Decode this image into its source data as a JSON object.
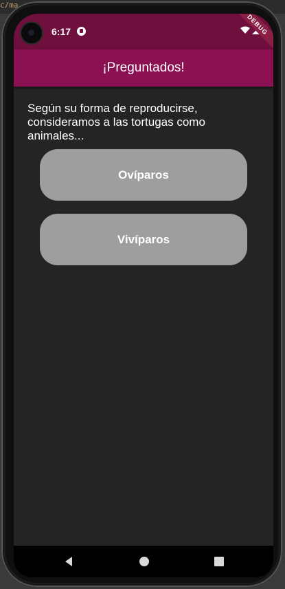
{
  "editor": {
    "path_fragment": "c/ma"
  },
  "status_bar": {
    "time": "6:17",
    "debug_badge": "DEBUG"
  },
  "app_bar": {
    "title": "¡Preguntados!"
  },
  "question": {
    "text": "Según su forma de reproducirse, consideramos a las tortugas como animales..."
  },
  "answers": [
    {
      "label": "Ovíparos"
    },
    {
      "label": "Vivíparos"
    }
  ],
  "colors": {
    "status_bar": "#6e0f3e",
    "app_bar": "#8b1153",
    "background": "#242424",
    "button": "#9e9e9e"
  },
  "icons": {
    "status": [
      "wifi-icon",
      "signal-icon",
      "battery-icon"
    ],
    "nav": [
      "back-icon",
      "home-icon",
      "recents-icon"
    ]
  }
}
